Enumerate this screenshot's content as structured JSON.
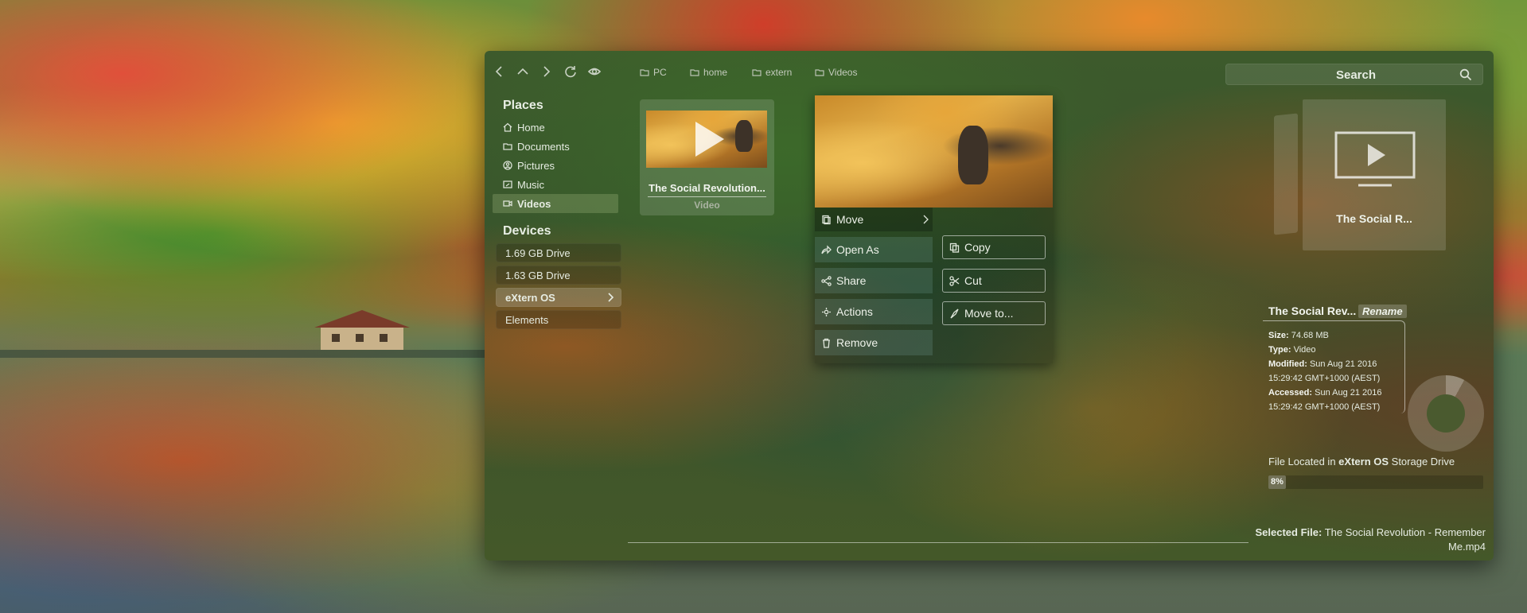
{
  "toolbar": {
    "icons": [
      "back-icon",
      "up-icon",
      "forward-icon",
      "refresh-icon",
      "eye-icon"
    ],
    "breadcrumbs": [
      "PC",
      "home",
      "extern",
      "Videos"
    ],
    "search_placeholder": "Search"
  },
  "sidebar": {
    "places_title": "Places",
    "places": [
      {
        "label": "Home",
        "icon": "home-icon"
      },
      {
        "label": "Documents",
        "icon": "folder-icon"
      },
      {
        "label": "Pictures",
        "icon": "picture-icon"
      },
      {
        "label": "Music",
        "icon": "music-icon"
      },
      {
        "label": "Videos",
        "icon": "video-icon",
        "active": true
      }
    ],
    "devices_title": "Devices",
    "devices": [
      {
        "label": "1.69 GB Drive"
      },
      {
        "label": "1.63 GB Drive"
      },
      {
        "label": "eXtern OS",
        "active": true
      },
      {
        "label": "Elements"
      }
    ]
  },
  "file": {
    "name": "The Social Revolution...",
    "type": "Video"
  },
  "context_menu": {
    "left": [
      {
        "label": "Move",
        "icon": "move-icon",
        "has_submenu": true
      },
      {
        "label": "Open As",
        "icon": "share-arrow-icon"
      },
      {
        "label": "Share",
        "icon": "share-icon"
      },
      {
        "label": "Actions",
        "icon": "actions-icon"
      },
      {
        "label": "Remove",
        "icon": "trash-icon"
      }
    ],
    "right": [
      {
        "label": "Copy",
        "icon": "copy-icon"
      },
      {
        "label": "Cut",
        "icon": "scissors-icon"
      },
      {
        "label": "Move to...",
        "icon": "move-to-icon"
      }
    ]
  },
  "preview": {
    "name": "The Social R..."
  },
  "details": {
    "name": "The Social Rev...",
    "rename_label": "Rename",
    "size_label": "Size:",
    "size_value": "74.68 MB",
    "type_label": "Type:",
    "type_value": "Video",
    "modified_label": "Modified:",
    "modified_value_1": "Sun Aug 21 2016",
    "modified_value_2": "15:29:42 GMT+1000 (AEST)",
    "accessed_label": "Accessed:",
    "accessed_value_1": "Sun Aug 21 2016",
    "accessed_value_2": "15:29:42 GMT+1000 (AEST)"
  },
  "storage": {
    "text_prefix": "File Located in ",
    "drive_name": "eXtern OS",
    "text_suffix": " Storage Drive",
    "percent_label": "8%",
    "percent_value": 0.08
  },
  "status": {
    "selected_label": "Selected File:",
    "selected_value": "The Social Revolution - Remember Me.mp4"
  }
}
